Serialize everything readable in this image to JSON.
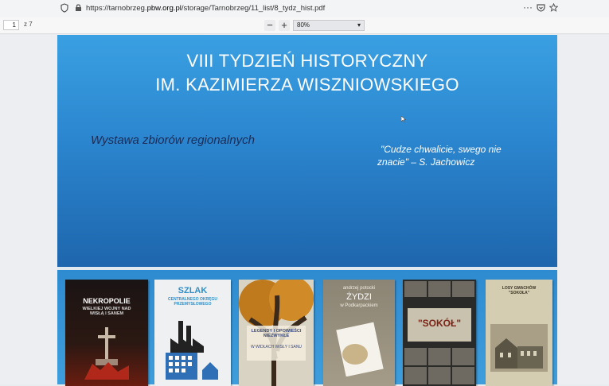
{
  "browser": {
    "url_prefix": "https://tarnobrzeg.",
    "url_domain": "pbw.org.pl",
    "url_path": "/storage/Tarnobrzeg/11_list/8_tydz_hist.pdf",
    "menu_glyph": "···"
  },
  "pdf_toolbar": {
    "page_number": "1",
    "page_total": "z 7",
    "zoom_out": "−",
    "zoom_in": "+",
    "zoom_value": "80%"
  },
  "slide": {
    "title_line1": "VIII TYDZIEŃ HISTORYCZNY",
    "title_line2": "IM. KAZIMIERZA WISZNIOWSKIEGO",
    "subtitle": "Wystawa zbiorów regionalnych",
    "quote_line1": "\"Cudze chwalicie, swego nie",
    "quote_line2": "znacie\" – S. Jachowicz"
  },
  "books": [
    {
      "title": "NEKROPOLIE",
      "subtitle": "WIELKIEJ WOJNY NAD WISŁĄ I SANEM"
    },
    {
      "title": "SZLAK",
      "subtitle": "CENTRALNEGO OKRĘGU PRZEMYSŁOWEGO"
    },
    {
      "title": "LEGENDY I OPOWIEŚCI NIEZWYKŁE",
      "subtitle": "W WIDŁACH WISŁY I SANU"
    },
    {
      "title": "ŻYDZI",
      "author": "andrzej potocki",
      "subtitle": "w Podkarpackiem"
    },
    {
      "title": "\"SOKÓŁ\"",
      "subtitle": ""
    },
    {
      "title": "LOSY GMACHÓW \"SOKOŁA\"",
      "subtitle": ""
    }
  ]
}
